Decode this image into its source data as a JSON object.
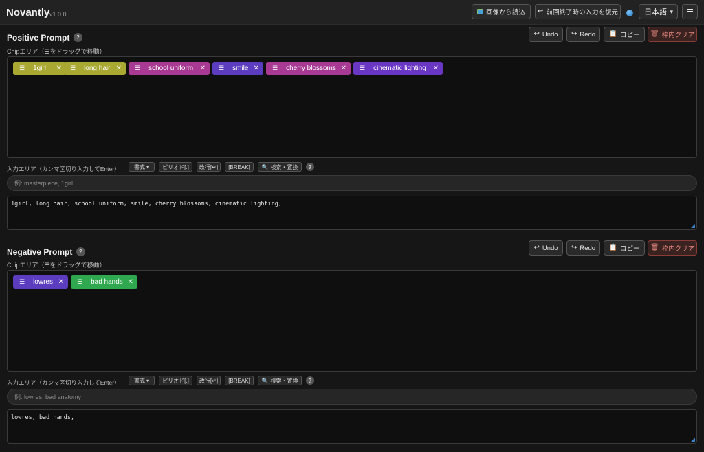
{
  "header": {
    "brand": "Novantly",
    "version": "v1.0.0",
    "load_from_image": "画像から読込",
    "restore_last": "前回終了時の入力を復元",
    "language": "日本語"
  },
  "positive": {
    "title": "Positive Prompt",
    "help": "?",
    "undo": "Undo",
    "redo": "Redo",
    "copy": "コピー",
    "clear": "枠内クリア",
    "chip_area_label": "Chipエリア（☰をドラッグで移動）",
    "chips": [
      {
        "label": "1girl",
        "color": "#a8a832"
      },
      {
        "label": "long hair",
        "color": "#a8a832"
      },
      {
        "label": "school uniform",
        "color": "#a83a93"
      },
      {
        "label": "smile",
        "color": "#5c3dbf"
      },
      {
        "label": "cherry blossoms",
        "color": "#a83a93"
      },
      {
        "label": "cinematic lighting",
        "color": "#6a36c4"
      }
    ],
    "input_label": "入力エリア（カンマ区切り入力してEnter）",
    "tools": {
      "format": "書式 ▾",
      "period": "ピリオド[.]",
      "newline": "改行[↵]",
      "break": "[BREAK]",
      "search": "検索・置換"
    },
    "placeholder": "例: masterpiece, 1girl",
    "text": "1girl, long hair, school uniform, smile, cherry blossoms, cinematic lighting,"
  },
  "negative": {
    "title": "Negative Prompt",
    "help": "?",
    "undo": "Undo",
    "redo": "Redo",
    "copy": "コピー",
    "clear": "枠内クリア",
    "chip_area_label": "Chipエリア（☰をドラッグで移動）",
    "chips": [
      {
        "label": "lowres",
        "color": "#5c3dbf"
      },
      {
        "label": "bad hands",
        "color": "#2fa84f"
      }
    ],
    "input_label": "入力エリア（カンマ区切り入力してEnter）",
    "tools": {
      "format": "書式 ▾",
      "period": "ピリオド[.]",
      "newline": "改行[↵]",
      "break": "[BREAK]",
      "search": "検索・置換"
    },
    "placeholder": "例: lowres, bad anatomy",
    "text": "lowres, bad hands,"
  }
}
